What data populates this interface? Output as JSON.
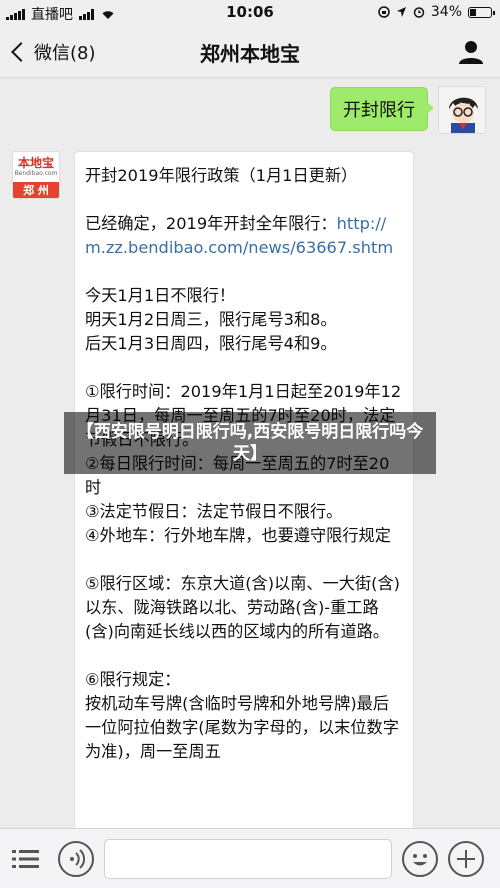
{
  "status_bar": {
    "carrier": "直播吧",
    "time": "10:06",
    "battery": "34%",
    "battery_level": 0.34
  },
  "nav": {
    "back_label": "微信(8)",
    "title": "郑州本地宝",
    "profile_icon": "person-icon"
  },
  "outgoing_message": {
    "text": "开封限行"
  },
  "bot_avatar": {
    "logo_text": "本地宝",
    "logo_domain": "Bendibao.com",
    "city": "郑 州"
  },
  "incoming_message": {
    "title": "开封2019年限行政策（1月1日更新）",
    "intro": "已经确定，2019年开封全年限行：",
    "link": "http://m.zz.bendibao.com/news/63667.shtm",
    "today": "今天1月1日不限行！",
    "tomorrow": "明天1月2日周三，限行尾号3和8。",
    "day_after": "后天1月3日周四，限行尾号4和9。",
    "item1": "①限行时间：2019年1月1日起至2019年12月31日，每周一至周五的7时至20时，法定节假日不限行。",
    "item2": "②每日限行时间：每周一至周五的7时至20时",
    "item3": "③法定节假日：法定节假日不限行。",
    "item4": "④外地车：行外地车牌，也要遵守限行规定",
    "item5": "⑤限行区域：东京大道(含)以南、一大街(含)以东、陇海铁路以北、劳动路(含)-重工路(含)向南延长线以西的区域内的所有道路。",
    "item6_title": "⑥限行规定：",
    "item6_body": "按机动车号牌(含临时号牌和外地号牌)最后一位阿拉伯数字(尾数为字母的，以末位数字为准)，周一至周五"
  },
  "overlay": {
    "caption": "【西安限号明日限行吗,西安限号明日限行吗今天】"
  },
  "input_bar": {
    "menu_icon": "menu-icon",
    "voice_icon": "voice-icon",
    "emoji_icon": "emoji-icon",
    "plus_icon": "plus-icon"
  }
}
